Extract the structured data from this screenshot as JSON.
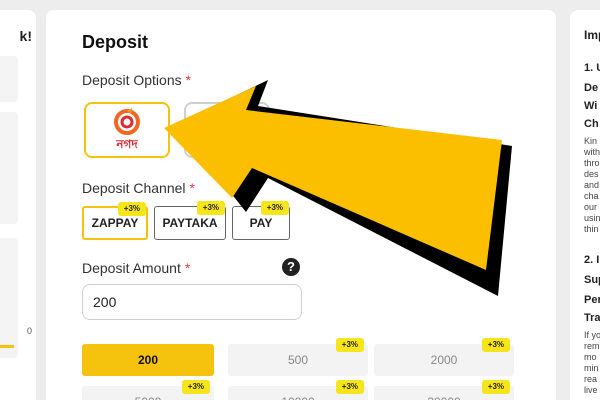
{
  "left_panel": {
    "title": "k!",
    "amount_fragment": "0"
  },
  "main": {
    "title": "Deposit",
    "options_label": "Deposit Options",
    "required_mark": "*",
    "options": [
      {
        "caption": "নগদ",
        "icon": "nagad-logo-icon",
        "selected": true
      },
      {
        "caption": "",
        "icon": "",
        "selected": false
      }
    ],
    "channel_label": "Deposit Channel",
    "channels": [
      {
        "label": "ZAPPAY",
        "bonus": "+3%",
        "selected": true
      },
      {
        "label": "PAYTAKA",
        "bonus": "+3%",
        "selected": false
      },
      {
        "label": "PAY",
        "bonus": "+3%",
        "selected": false
      }
    ],
    "amount_label": "Deposit Amount",
    "help_icon": "question-circle-icon",
    "help_symbol": "?",
    "amount_value": "200",
    "amount_chips": [
      {
        "label": "200",
        "bonus": "",
        "selected": true
      },
      {
        "label": "500",
        "bonus": "+3%",
        "selected": false
      },
      {
        "label": "2000",
        "bonus": "+3%",
        "selected": false
      },
      {
        "label": "5000",
        "bonus": "+3%",
        "selected": false
      },
      {
        "label": "10000",
        "bonus": "+3%",
        "selected": false
      },
      {
        "label": "30000",
        "bonus": "+3%",
        "selected": false
      }
    ]
  },
  "right_panel": {
    "title": "Imp",
    "step1_heading": "1. U",
    "step1_line2": "De",
    "step1_line3": "Wi",
    "step1_line4": "Ch",
    "step1_text": [
      "Kin",
      "with",
      "thro",
      "des",
      "and",
      "cha",
      "our",
      "usin",
      "thin"
    ],
    "step2_heading": "2. I",
    "step2_line2": "Sup",
    "step2_line3": "Per",
    "step2_line4": "Tra",
    "step2_text": [
      "If yo",
      "rem",
      "mo",
      "min",
      "rea",
      "live"
    ]
  },
  "colors": {
    "accent": "#f5c20d",
    "bonus_tag": "#f5e51a",
    "required": "#e53935",
    "arrow_fill": "#fbbf00",
    "arrow_shadow": "#000000"
  }
}
